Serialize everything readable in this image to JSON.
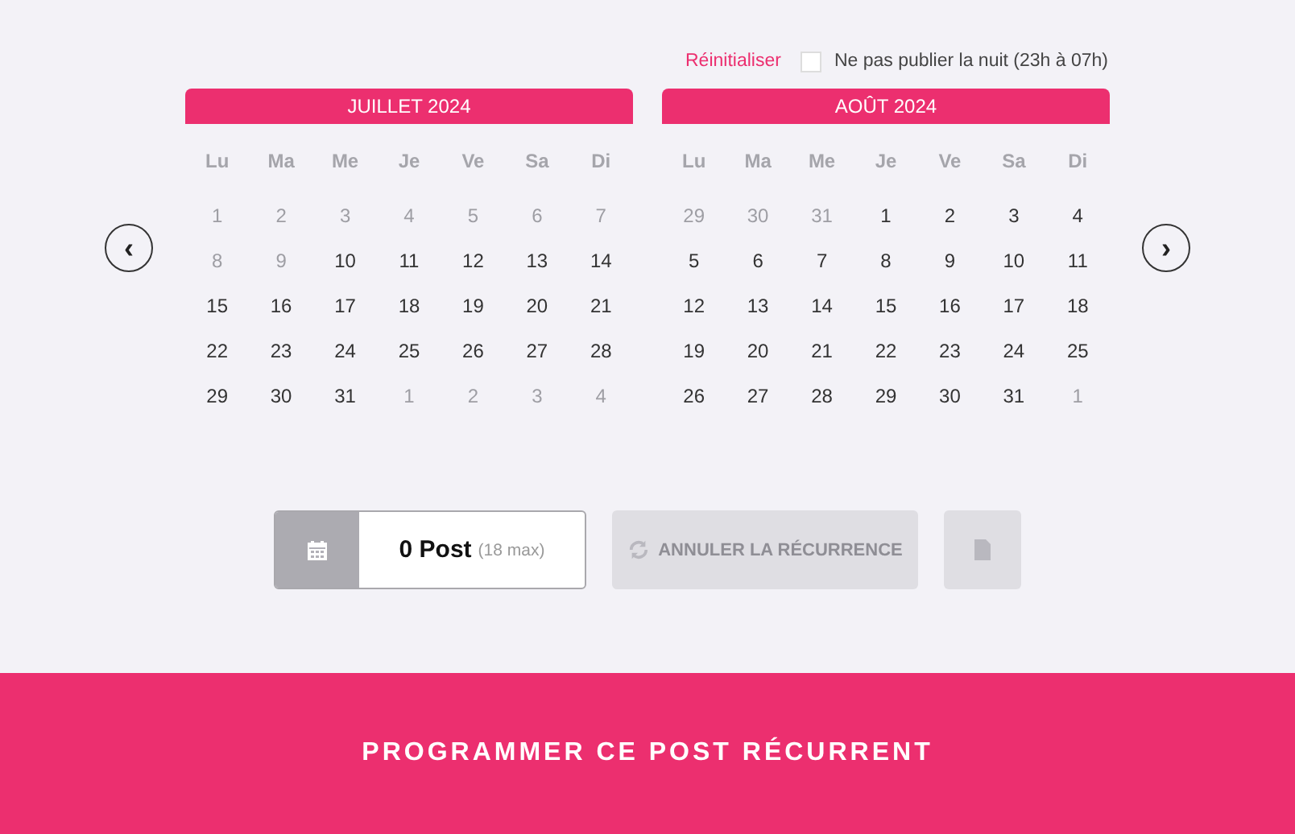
{
  "options": {
    "reset_link": "Réinitialiser",
    "night_option": {
      "label": "Ne pas publier la nuit (23h à 07h)",
      "checked": false
    }
  },
  "navigation": {
    "previous": "‹",
    "next": "›"
  },
  "months": [
    {
      "title": "JUILLET 2024",
      "weekdays": [
        "Lu",
        "Ma",
        "Me",
        "Je",
        "Ve",
        "Sa",
        "Di"
      ],
      "weeks": [
        [
          {
            "day": "1",
            "disabled": true
          },
          {
            "day": "2",
            "disabled": true
          },
          {
            "day": "3",
            "disabled": true
          },
          {
            "day": "4",
            "disabled": true
          },
          {
            "day": "5",
            "disabled": true
          },
          {
            "day": "6",
            "disabled": true
          },
          {
            "day": "7",
            "disabled": true
          }
        ],
        [
          {
            "day": "8",
            "disabled": true
          },
          {
            "day": "9",
            "disabled": true
          },
          {
            "day": "10",
            "disabled": false
          },
          {
            "day": "11",
            "disabled": false
          },
          {
            "day": "12",
            "disabled": false
          },
          {
            "day": "13",
            "disabled": false
          },
          {
            "day": "14",
            "disabled": false
          }
        ],
        [
          {
            "day": "15",
            "disabled": false
          },
          {
            "day": "16",
            "disabled": false
          },
          {
            "day": "17",
            "disabled": false
          },
          {
            "day": "18",
            "disabled": false
          },
          {
            "day": "19",
            "disabled": false
          },
          {
            "day": "20",
            "disabled": false
          },
          {
            "day": "21",
            "disabled": false
          }
        ],
        [
          {
            "day": "22",
            "disabled": false
          },
          {
            "day": "23",
            "disabled": false
          },
          {
            "day": "24",
            "disabled": false
          },
          {
            "day": "25",
            "disabled": false
          },
          {
            "day": "26",
            "disabled": false
          },
          {
            "day": "27",
            "disabled": false
          },
          {
            "day": "28",
            "disabled": false
          }
        ],
        [
          {
            "day": "29",
            "disabled": false
          },
          {
            "day": "30",
            "disabled": false
          },
          {
            "day": "31",
            "disabled": false
          },
          {
            "day": "1",
            "disabled": true
          },
          {
            "day": "2",
            "disabled": true
          },
          {
            "day": "3",
            "disabled": true
          },
          {
            "day": "4",
            "disabled": true
          }
        ]
      ]
    },
    {
      "title": "AOÛT 2024",
      "weekdays": [
        "Lu",
        "Ma",
        "Me",
        "Je",
        "Ve",
        "Sa",
        "Di"
      ],
      "weeks": [
        [
          {
            "day": "29",
            "disabled": true
          },
          {
            "day": "30",
            "disabled": true
          },
          {
            "day": "31",
            "disabled": true
          },
          {
            "day": "1",
            "disabled": false
          },
          {
            "day": "2",
            "disabled": false
          },
          {
            "day": "3",
            "disabled": false
          },
          {
            "day": "4",
            "disabled": false
          }
        ],
        [
          {
            "day": "5",
            "disabled": false
          },
          {
            "day": "6",
            "disabled": false
          },
          {
            "day": "7",
            "disabled": false
          },
          {
            "day": "8",
            "disabled": false
          },
          {
            "day": "9",
            "disabled": false
          },
          {
            "day": "10",
            "disabled": false
          },
          {
            "day": "11",
            "disabled": false
          }
        ],
        [
          {
            "day": "12",
            "disabled": false
          },
          {
            "day": "13",
            "disabled": false
          },
          {
            "day": "14",
            "disabled": false
          },
          {
            "day": "15",
            "disabled": false
          },
          {
            "day": "16",
            "disabled": false
          },
          {
            "day": "17",
            "disabled": false
          },
          {
            "day": "18",
            "disabled": false
          }
        ],
        [
          {
            "day": "19",
            "disabled": false
          },
          {
            "day": "20",
            "disabled": false
          },
          {
            "day": "21",
            "disabled": false
          },
          {
            "day": "22",
            "disabled": false
          },
          {
            "day": "23",
            "disabled": false
          },
          {
            "day": "24",
            "disabled": false
          },
          {
            "day": "25",
            "disabled": false
          }
        ],
        [
          {
            "day": "26",
            "disabled": false
          },
          {
            "day": "27",
            "disabled": false
          },
          {
            "day": "28",
            "disabled": false
          },
          {
            "day": "29",
            "disabled": false
          },
          {
            "day": "30",
            "disabled": false
          },
          {
            "day": "31",
            "disabled": false
          },
          {
            "day": "1",
            "disabled": true
          }
        ]
      ]
    }
  ],
  "post_counter": {
    "count": "0 Post",
    "limit": "(18 max)"
  },
  "cancel_recurrence_button": {
    "label": "ANNULER LA RÉCURRENCE",
    "disabled": true
  },
  "copy_button": {
    "disabled": true
  },
  "submit_button": {
    "label": "PROGRAMMER CE POST RÉCURRENT"
  }
}
